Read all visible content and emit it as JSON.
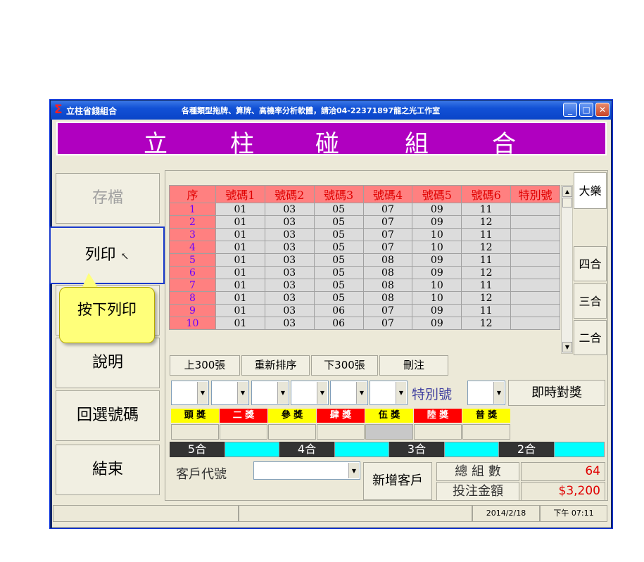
{
  "titlebar": {
    "app_name": "立柱省錢組合",
    "caption": "各種類型拖牌、算牌、高機率分析軟體，請洽04-22371897龍之光工作室"
  },
  "banner": {
    "chars": [
      "立",
      "柱",
      "碰",
      "組",
      "合"
    ]
  },
  "sidebar": {
    "save": "存檔",
    "print": "列印",
    "help": "說明",
    "reselect": "回選號碼",
    "exit": "結束"
  },
  "tooltip": {
    "text": "按下列印"
  },
  "table": {
    "headers": [
      "序",
      "號碼1",
      "號碼2",
      "號碼3",
      "號碼4",
      "號碼5",
      "號碼6",
      "特別號"
    ],
    "rows": [
      [
        "1",
        "01",
        "03",
        "05",
        "07",
        "09",
        "11",
        ""
      ],
      [
        "2",
        "01",
        "03",
        "05",
        "07",
        "09",
        "12",
        ""
      ],
      [
        "3",
        "01",
        "03",
        "05",
        "07",
        "10",
        "11",
        ""
      ],
      [
        "4",
        "01",
        "03",
        "05",
        "07",
        "10",
        "12",
        ""
      ],
      [
        "5",
        "01",
        "03",
        "05",
        "08",
        "09",
        "11",
        ""
      ],
      [
        "6",
        "01",
        "03",
        "05",
        "08",
        "09",
        "12",
        ""
      ],
      [
        "7",
        "01",
        "03",
        "05",
        "08",
        "10",
        "11",
        ""
      ],
      [
        "8",
        "01",
        "03",
        "05",
        "08",
        "10",
        "12",
        ""
      ],
      [
        "9",
        "01",
        "03",
        "06",
        "07",
        "09",
        "11",
        ""
      ],
      [
        "10",
        "01",
        "03",
        "06",
        "07",
        "09",
        "12",
        ""
      ]
    ]
  },
  "side_tabs": {
    "dale": "大樂",
    "four": "四合",
    "three": "三合",
    "two": "二合"
  },
  "table_buttons": {
    "prev": "上300張",
    "resort": "重新排序",
    "next": "下300張",
    "delete": "刪注"
  },
  "special_label": "特別號",
  "instant_check": "即時對獎",
  "prizes": [
    {
      "label": "頭 獎",
      "bg": "#ffff00",
      "fg": "#000000"
    },
    {
      "label": "二 獎",
      "bg": "#ff0000",
      "fg": "#ffffff"
    },
    {
      "label": "參 獎",
      "bg": "#ffff00",
      "fg": "#000000"
    },
    {
      "label": "肆 獎",
      "bg": "#ff0000",
      "fg": "#ffffff"
    },
    {
      "label": "伍 獎",
      "bg": "#ffff00",
      "fg": "#000000"
    },
    {
      "label": "陸 獎",
      "bg": "#ff0000",
      "fg": "#ffffff"
    },
    {
      "label": "普 獎",
      "bg": "#ffff00",
      "fg": "#000000"
    }
  ],
  "he_labels": [
    "5合",
    "4合",
    "3合",
    "2合"
  ],
  "customer": {
    "label": "客戶代號",
    "add_button": "新增客戶"
  },
  "totals": {
    "count_label": "總 組 數",
    "count_value": "64",
    "amount_label": "投注金額",
    "amount_value": "$3,200"
  },
  "statusbar": {
    "date": "2014/2/18",
    "time": "下午 07:11"
  }
}
